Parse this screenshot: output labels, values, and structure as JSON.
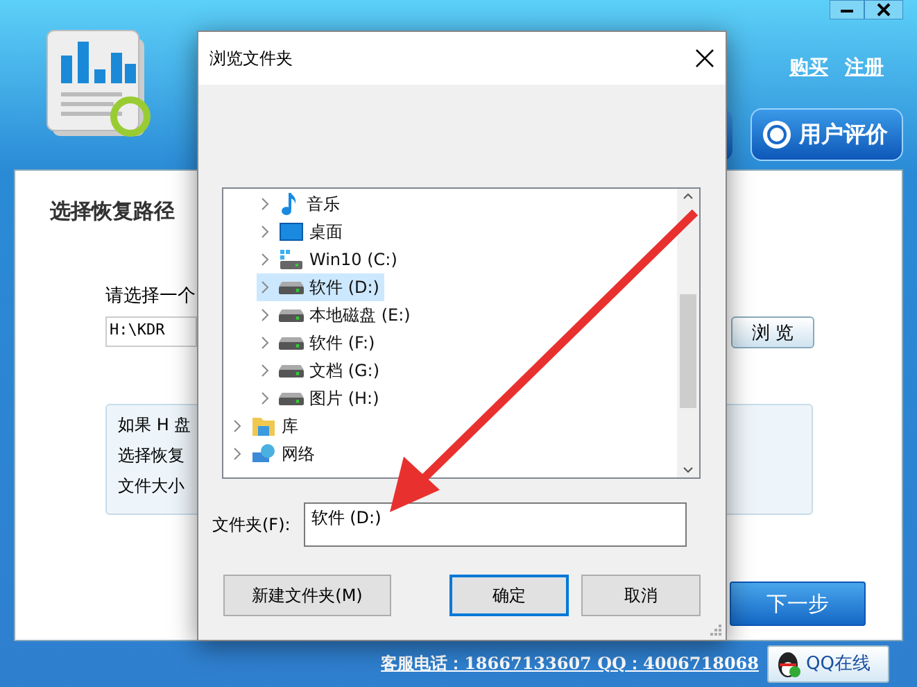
{
  "app": {
    "links": [
      "购买",
      "注册"
    ],
    "review_button": "用户评价",
    "section_title": "选择恢复路径",
    "prompt": "请选择一个",
    "path_value": "H:\\KDR",
    "browse_button": "浏 览",
    "info_lines": [
      "如果 H 盘",
      "选择恢复",
      "文件大小"
    ],
    "next_button": "下一步",
    "footer_contact": "客服电话：18667133607 QQ：4006718068",
    "qq_button": "QQ在线"
  },
  "dialog": {
    "title": "浏览文件夹",
    "tree": [
      {
        "children": [
          {
            "label": "音乐",
            "kind": "music",
            "selected": false
          },
          {
            "label": "桌面",
            "kind": "desktop",
            "selected": false
          },
          {
            "label": "Win10 (C:)",
            "kind": "system-drive",
            "selected": false
          },
          {
            "label": "软件 (D:)",
            "kind": "drive",
            "selected": true
          },
          {
            "label": "本地磁盘 (E:)",
            "kind": "drive",
            "selected": false
          },
          {
            "label": "软件 (F:)",
            "kind": "drive",
            "selected": false
          },
          {
            "label": "文档 (G:)",
            "kind": "drive",
            "selected": false
          },
          {
            "label": "图片 (H:)",
            "kind": "drive",
            "selected": false
          }
        ]
      },
      {
        "label": "库",
        "kind": "library",
        "selected": false
      },
      {
        "label": "网络",
        "kind": "network",
        "selected": false
      }
    ],
    "folder_label": "文件夹(F):",
    "folder_value": "软件 (D:)",
    "buttons": [
      {
        "label": "新建文件夹(M)",
        "default": false
      },
      {
        "label": "确定",
        "default": true
      },
      {
        "label": "取消",
        "default": false
      }
    ]
  }
}
